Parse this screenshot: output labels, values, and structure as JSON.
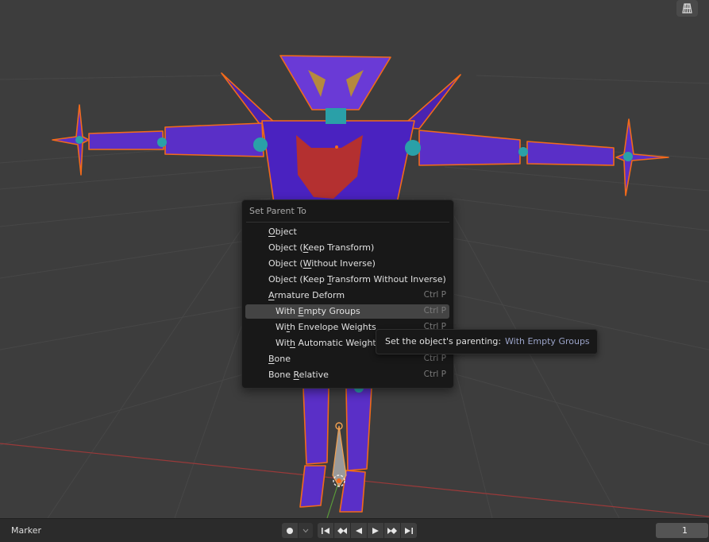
{
  "menu": {
    "title": "Set Parent To",
    "items": [
      {
        "pre": "",
        "u": "O",
        "post": "bject",
        "shortcut": ""
      },
      {
        "pre": "Object (",
        "u": "K",
        "post": "eep Transform)",
        "shortcut": ""
      },
      {
        "pre": "Object (",
        "u": "W",
        "post": "ithout Inverse)",
        "shortcut": ""
      },
      {
        "pre": "Object (Keep ",
        "u": "T",
        "post": "ransform Without Inverse)",
        "shortcut": ""
      },
      {
        "pre": "",
        "u": "A",
        "post": "rmature Deform",
        "shortcut": "Ctrl P"
      },
      {
        "pre": "With ",
        "u": "E",
        "post": "mpty Groups",
        "shortcut": "Ctrl P"
      },
      {
        "pre": "Wi",
        "u": "t",
        "post": "h Envelope Weights",
        "shortcut": "Ctrl P"
      },
      {
        "pre": "Wit",
        "u": "h",
        "post": " Automatic Weights",
        "shortcut": ""
      },
      {
        "pre": "",
        "u": "B",
        "post": "one",
        "shortcut": "Ctrl P"
      },
      {
        "pre": "Bone ",
        "u": "R",
        "post": "elative",
        "shortcut": "Ctrl P"
      }
    ]
  },
  "tooltip": {
    "label": "Set the object's parenting:",
    "value": "With Empty Groups"
  },
  "timeline": {
    "marker_label": "Marker",
    "current_frame": "1"
  },
  "icons": {
    "gizmo": "grid-view-icon",
    "keyframe": "record-dot-icon",
    "dropdown": "chevron-down-icon",
    "jump_start": "jump-to-start-icon",
    "prev_keyframe": "previous-keyframe-icon",
    "play_reverse": "play-reverse-icon",
    "play": "play-icon",
    "next_keyframe": "next-keyframe-icon",
    "jump_end": "jump-to-end-icon"
  },
  "colors": {
    "highlight": "#444444",
    "menu_bg": "#181818",
    "tooltip_value": "#9aa3c8",
    "robot_body": "#5a2fc7",
    "selection_outline": "#f26a1b"
  }
}
